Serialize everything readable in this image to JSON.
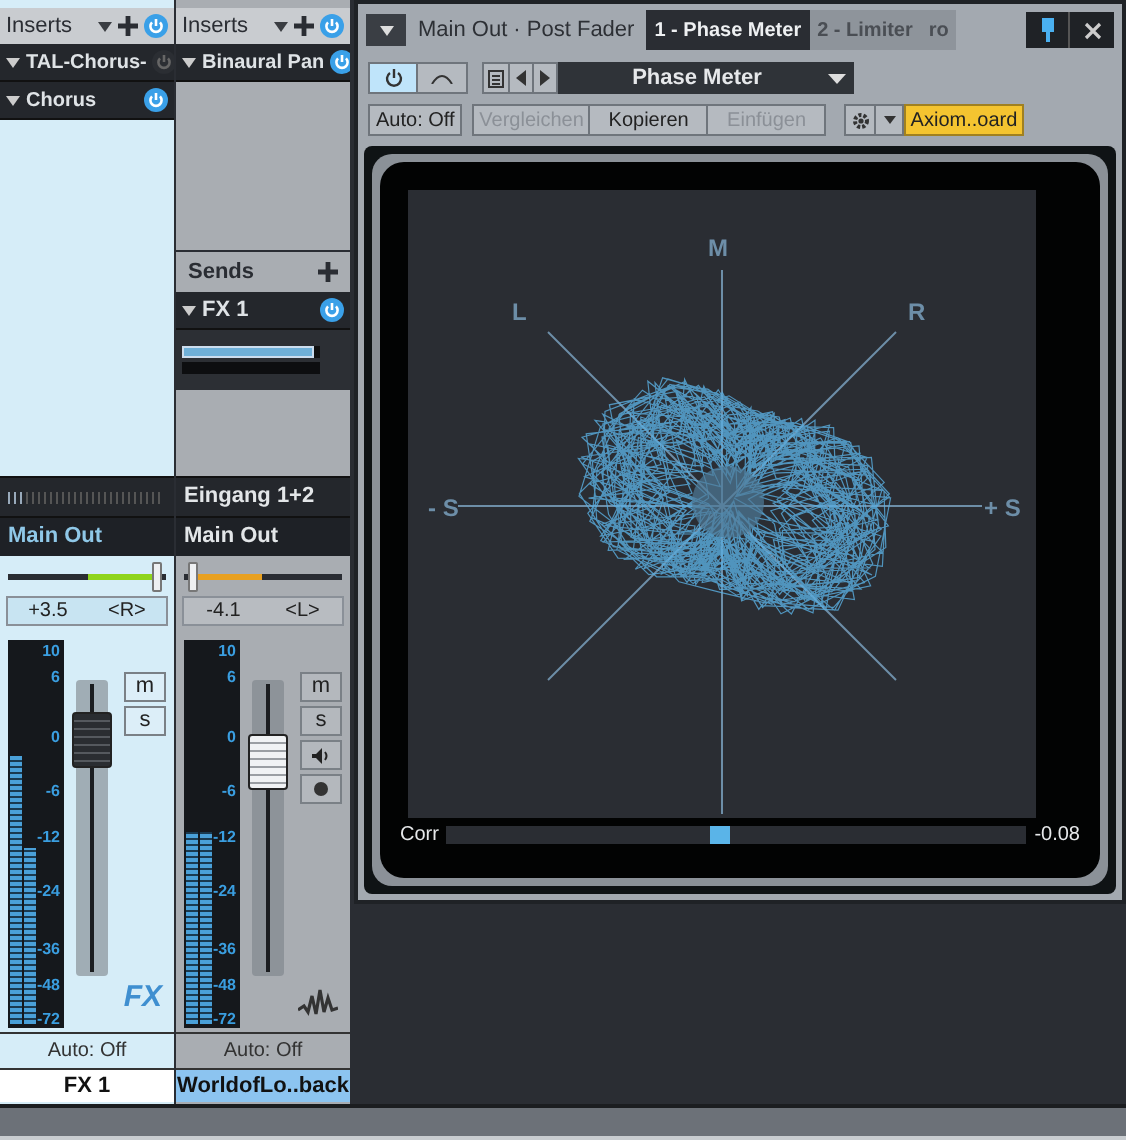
{
  "channels": [
    {
      "kind": "fx",
      "inserts_label": "Inserts",
      "inserts": [
        {
          "name": "TAL-Chorus-",
          "on": false
        },
        {
          "name": "Chorus",
          "on": true
        }
      ],
      "output": "Main Out",
      "pan": {
        "level": 0.97,
        "reading": "+3.5",
        "side": "<R>"
      },
      "scale": [
        "10",
        "6",
        "0",
        "-6",
        "-12",
        "-24",
        "-36",
        "-48",
        "-72"
      ],
      "meters": [
        {
          "level": 0.7
        },
        {
          "level": 0.46
        }
      ],
      "fader": {
        "level": 0.8
      },
      "buttons": [
        {
          "kind": "text",
          "label": "m"
        },
        {
          "kind": "text",
          "label": "s"
        }
      ],
      "type_label": "FX",
      "automation": "Auto: Off",
      "name": "FX 1",
      "selected": false
    },
    {
      "kind": "audio",
      "inserts_label": "Inserts",
      "inserts": [
        {
          "name": "Binaural Pan",
          "on": true
        }
      ],
      "sends_label": "Sends",
      "sends": [
        {
          "name": "FX 1",
          "on": true,
          "level": 0.95,
          "meter": {
            "level": 0
          }
        }
      ],
      "input": "Eingang 1+2",
      "output": "Main Out",
      "pan": {
        "level": 0.03,
        "reading": "-4.1",
        "side": "<L>"
      },
      "scale": [
        "10",
        "6",
        "0",
        "-6",
        "-12",
        "-24",
        "-36",
        "-48",
        "-72"
      ],
      "meters": [
        {
          "level": 0.5
        },
        {
          "level": 0.5
        }
      ],
      "fader": {
        "level": 0.72
      },
      "buttons": [
        {
          "kind": "text",
          "label": "m"
        },
        {
          "kind": "text",
          "label": "s"
        },
        {
          "kind": "speaker"
        },
        {
          "kind": "record"
        }
      ],
      "automation": "Auto: Off",
      "name": "WorldofLo..back",
      "selected": true
    }
  ],
  "plugin": {
    "title": "Main Out · Post Fader",
    "tabs": [
      {
        "label": "1 - Phase Meter",
        "selected": true
      },
      {
        "label": "2 - Limiter",
        "selected": false
      },
      {
        "label": "ro",
        "selected": false
      }
    ],
    "power_on": true,
    "preset": "Phase Meter",
    "automation": "Auto: Off",
    "actions": [
      {
        "label": "Vergleichen",
        "disabled": true
      },
      {
        "label": "Kopieren",
        "disabled": false
      },
      {
        "label": "Einfügen",
        "disabled": true
      }
    ],
    "device": "Axiom..oard",
    "meter": {
      "axis_labels": {
        "top": "M",
        "left_diag": "L",
        "right_diag": "R",
        "left": "- S",
        "right": "+ S"
      },
      "corr_label": "Corr",
      "corr": {
        "level": 0.47
      },
      "corr_reading": "-0.08"
    }
  }
}
